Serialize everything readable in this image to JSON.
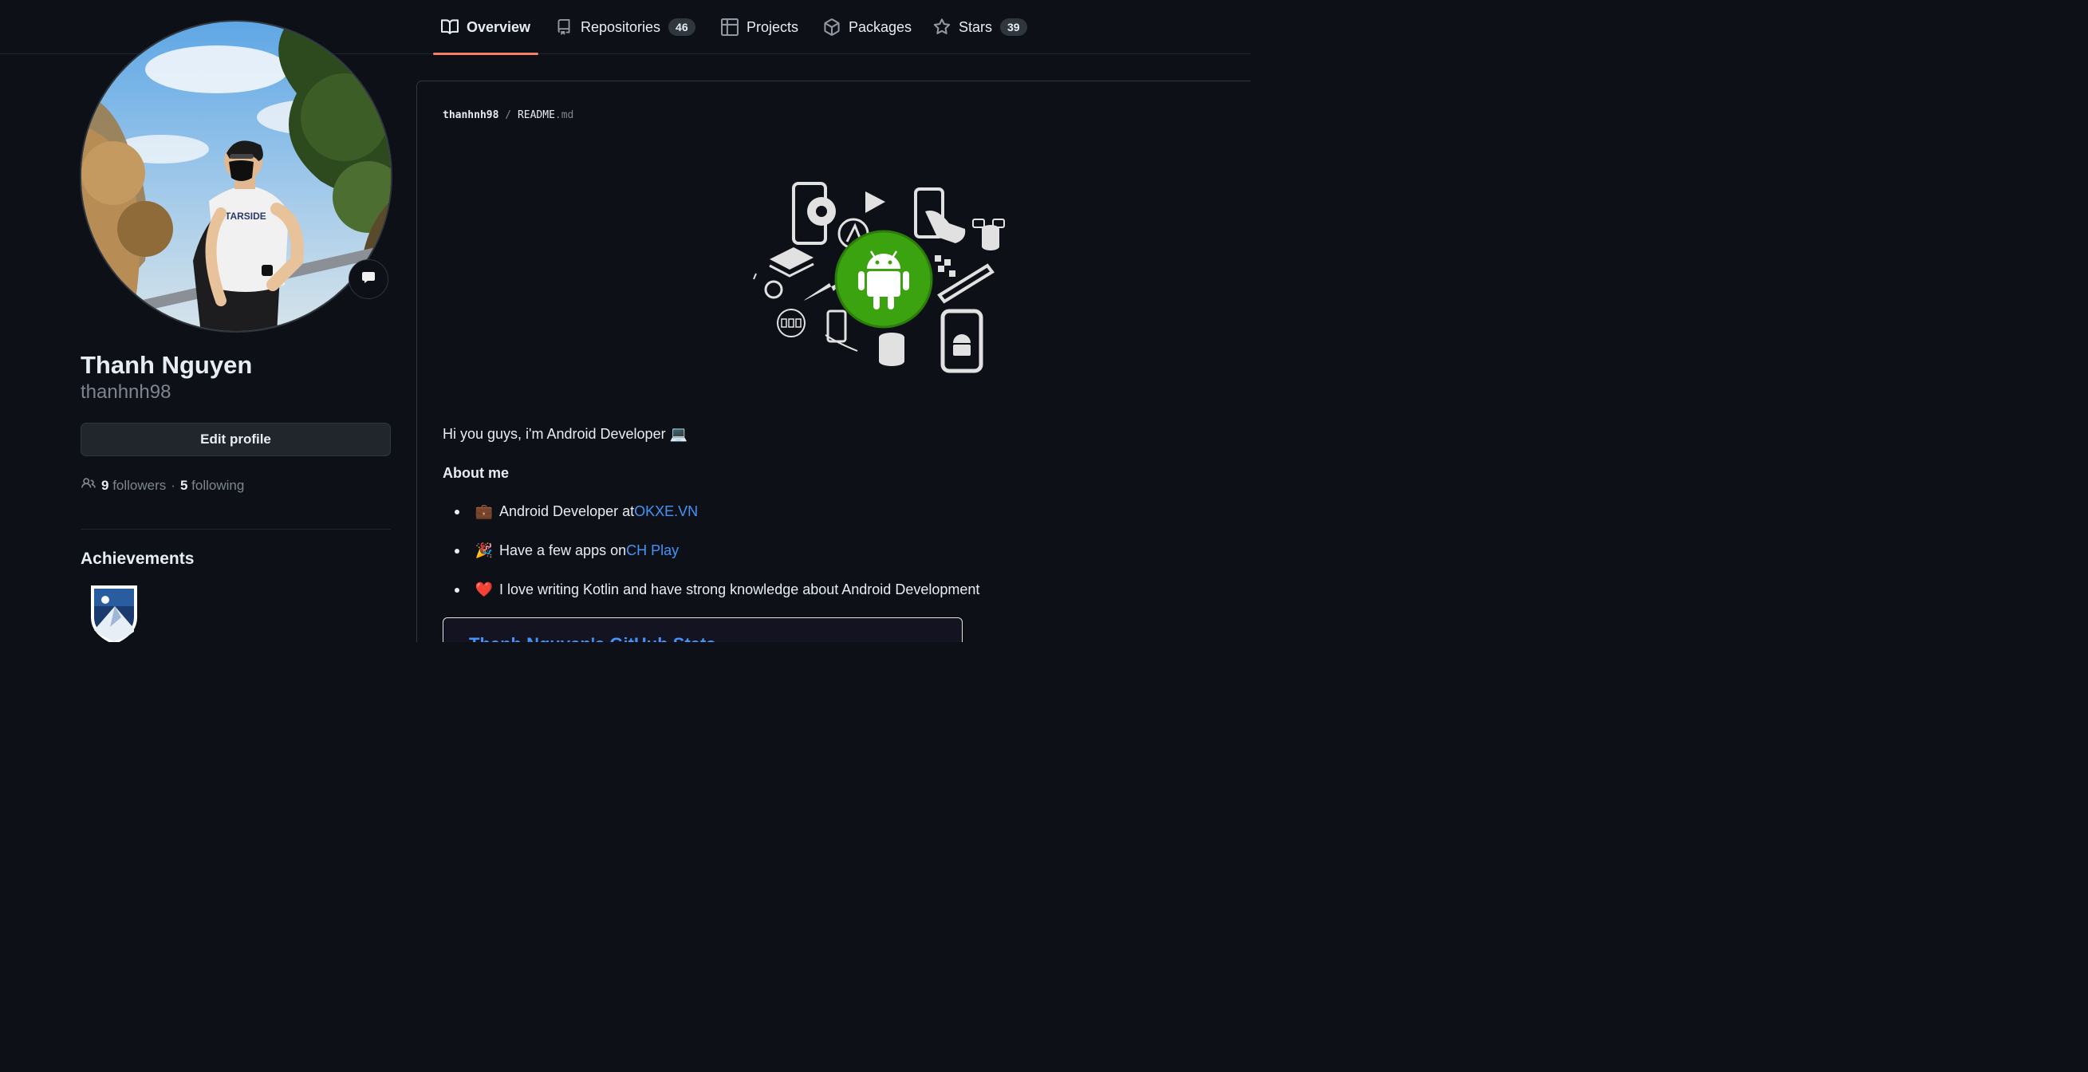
{
  "tabs": [
    {
      "label": "Overview",
      "icon": "book-icon",
      "active": true
    },
    {
      "label": "Repositories",
      "icon": "repo-icon",
      "count": "46"
    },
    {
      "label": "Projects",
      "icon": "table-icon"
    },
    {
      "label": "Packages",
      "icon": "package-icon"
    },
    {
      "label": "Stars",
      "icon": "star-icon",
      "count": "39"
    }
  ],
  "profile": {
    "name": "Thanh Nguyen",
    "login": "thanhnh98",
    "edit_label": "Edit profile",
    "followers_count": "9",
    "followers_label": "followers",
    "separator": "·",
    "following_count": "5",
    "following_label": "following",
    "achievements_title": "Achievements"
  },
  "readme": {
    "owner": "thanhnh98",
    "sep": "/",
    "file": "README",
    "ext": ".md",
    "intro": "Hi you guys, i'm Android Developer 💻",
    "about_title": "About me",
    "items": [
      {
        "emoji": "💼",
        "text": "Android Developer at ",
        "link": "OKXE.VN"
      },
      {
        "emoji": "🎉",
        "text": "Have a few apps on ",
        "link": "CH Play"
      },
      {
        "emoji": "❤️",
        "text": "I love writing Kotlin and have strong knowledge about Android Development",
        "link": ""
      }
    ],
    "stats_title": "Thanh Nguyen's GitHub Stats"
  },
  "colors": {
    "accent_tab": "#f78166",
    "link": "#4493f8",
    "android_green": "#3ba310"
  }
}
